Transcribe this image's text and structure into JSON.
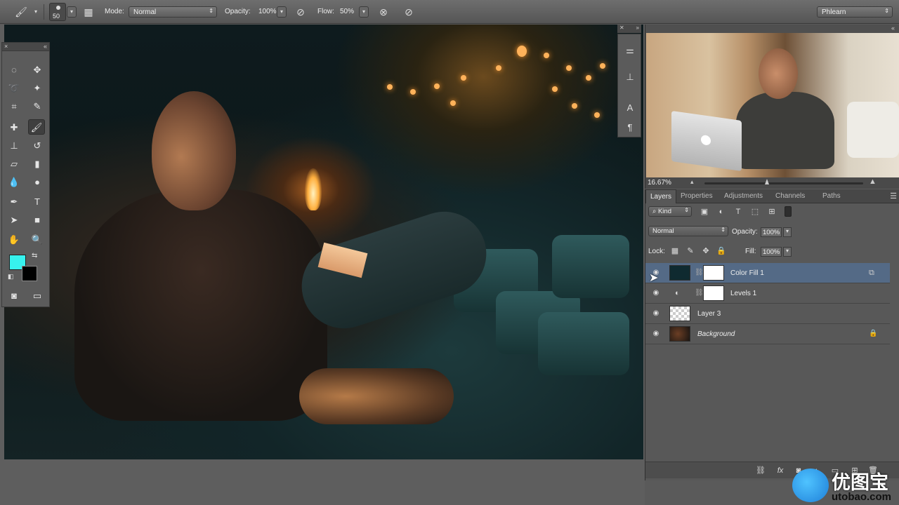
{
  "options_bar": {
    "brush_size": "50",
    "mode_label": "Mode:",
    "mode_value": "Normal",
    "opacity_label": "Opacity:",
    "opacity_value": "100%",
    "flow_label": "Flow:",
    "flow_value": "50%",
    "workspace": "Phlearn"
  },
  "tools": {
    "foreground_color": "#37f2ee",
    "background_color": "#000000",
    "items": [
      "marquee-icon",
      "move-icon",
      "lasso-icon",
      "magic-wand-icon",
      "crop-icon",
      "eyedropper-icon",
      "healing-brush-icon",
      "brush-icon",
      "clone-stamp-icon",
      "history-brush-icon",
      "eraser-icon",
      "gradient-icon",
      "blur-icon",
      "dodge-icon",
      "pen-icon",
      "type-icon",
      "path-selection-icon",
      "rectangle-icon",
      "hand-icon",
      "zoom-icon"
    ]
  },
  "navigator": {
    "zoom": "16.67%"
  },
  "layers_panel": {
    "tabs": [
      "Layers",
      "Properties",
      "Adjustments",
      "Channels",
      "Paths"
    ],
    "filter_kind": "Kind",
    "blend_mode": "Normal",
    "opacity_label": "Opacity:",
    "opacity_value": "100%",
    "lock_label": "Lock:",
    "fill_label": "Fill:",
    "fill_value": "100%",
    "layers": [
      {
        "name": "Color Fill 1",
        "selected": true
      },
      {
        "name": "Levels 1",
        "selected": false
      },
      {
        "name": "Layer 3",
        "selected": false
      },
      {
        "name": "Background",
        "selected": false,
        "locked": true
      }
    ],
    "footer_fx": "fx"
  },
  "watermark": {
    "title": "优图宝",
    "url": "utobao.com"
  }
}
